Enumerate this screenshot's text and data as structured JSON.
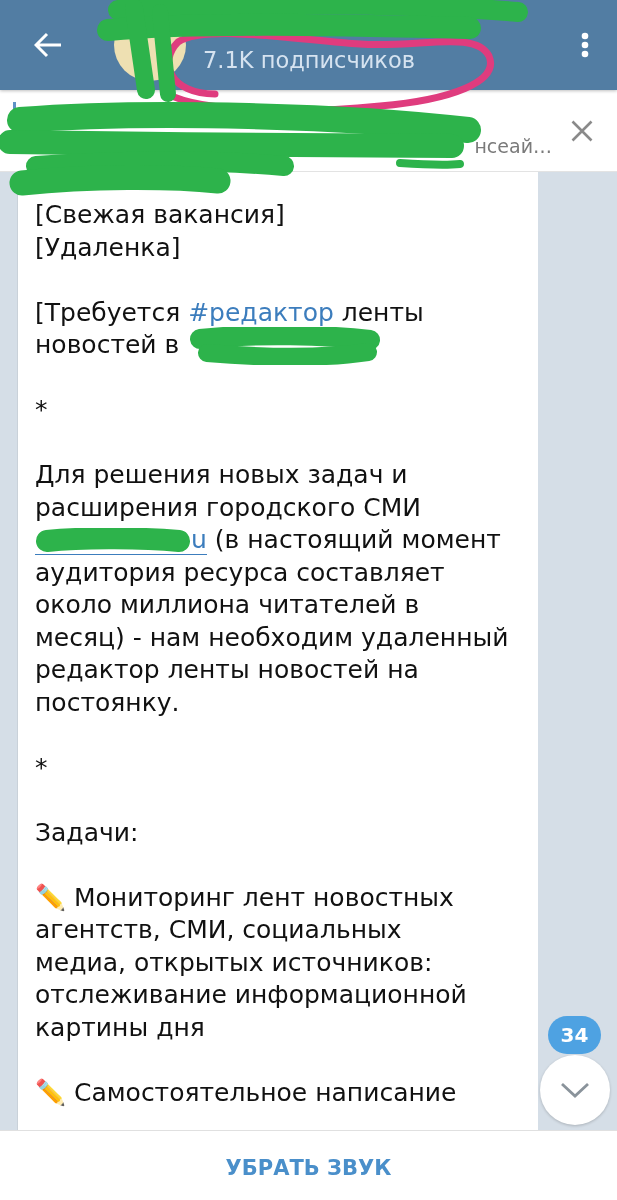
{
  "header": {
    "subtitle": "7.1K подписчиков"
  },
  "pinned_message": {
    "preview": "нсеай…"
  },
  "message": {
    "paragraphs": [
      {
        "parts": [
          {
            "kind": "plain",
            "text": "[Свежая вакансия]\n[Удаленка]"
          }
        ]
      },
      {
        "parts": [
          {
            "kind": "plain",
            "text": "[Требуется "
          },
          {
            "kind": "hashtag",
            "text": "#редактор"
          },
          {
            "kind": "plain",
            "text": " ленты\nновостей в "
          },
          {
            "kind": "redacted"
          }
        ]
      },
      {
        "parts": [
          {
            "kind": "plain",
            "text": "*"
          }
        ]
      },
      {
        "parts": [
          {
            "kind": "plain",
            "text": "Для решения новых задач и\nрасширения городского СМИ\n"
          },
          {
            "kind": "link",
            "redacted": true,
            "text": "u"
          },
          {
            "kind": "plain",
            "text": " (в настоящий момент\nаудитория ресурса составляет\nоколо миллиона читателей в\nмесяц) - нам необходим удаленный\nредактор ленты новостей на\nпостоянку."
          }
        ]
      },
      {
        "parts": [
          {
            "kind": "plain",
            "text": "*"
          }
        ]
      },
      {
        "parts": [
          {
            "kind": "plain",
            "text": "Задачи:"
          }
        ]
      },
      {
        "parts": [
          {
            "kind": "emoji",
            "text": "✏️"
          },
          {
            "kind": "plain",
            "text": " Мониторинг лент новостных\nагентств, СМИ, социальных\nмедиа, открытых источников:\nотслеживание информационной\nкартины дня"
          }
        ]
      },
      {
        "parts": [
          {
            "kind": "emoji",
            "text": "✏️"
          },
          {
            "kind": "plain",
            "text": " Самостоятельное написание"
          }
        ]
      }
    ]
  },
  "scroll_down": {
    "unread_count": "34"
  },
  "bottom_bar": {
    "button": "УБРАТЬ ЗВУК"
  }
}
